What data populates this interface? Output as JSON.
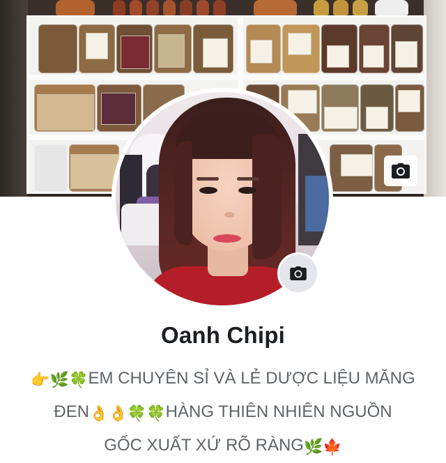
{
  "profile": {
    "name": "Oanh Chipi",
    "bio_lines": [
      {
        "pre": "👉🌿🍀",
        "text": "EM CHUYÊN SỈ VÀ LẺ DƯỢC LIỆU MĂNG",
        "post": ""
      },
      {
        "pre": "",
        "text": "ĐEN",
        "mid": "👌👌🍀🍀",
        "text2": "HÀNG THIÊN NHIÊN NGUỒN"
      },
      {
        "pre": "",
        "text": "GỐC XUẤT XỨ RÕ RÀNG",
        "post": "🌿🍁"
      }
    ]
  },
  "icons": {
    "cover_camera": "camera-icon",
    "avatar_camera": "camera-icon"
  },
  "colors": {
    "name": "#1c1e21",
    "bio": "#5f6368",
    "camera_badge": "#e4e6eb"
  }
}
